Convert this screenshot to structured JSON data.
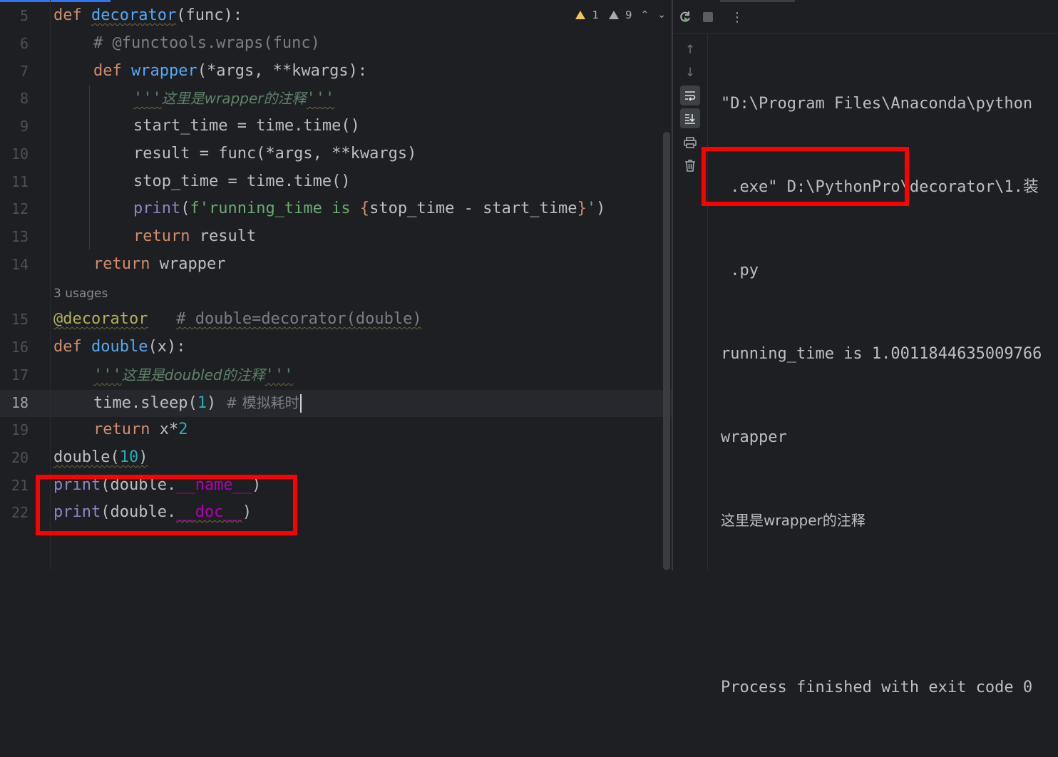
{
  "editor": {
    "line_numbers": [
      "5",
      "6",
      "7",
      "8",
      "9",
      "10",
      "11",
      "12",
      "13",
      "14",
      "15",
      "16",
      "17",
      "18",
      "19",
      "20",
      "21",
      "22"
    ],
    "active_line": "18",
    "usages_hint": "3 usages",
    "inspections": {
      "warnings": "1",
      "weak_warnings": "9"
    },
    "code": {
      "l5": {
        "kw": "def",
        "name": "decorator",
        "rest": "(func):"
      },
      "l6": {
        "comment": "# @functools.wraps(func)"
      },
      "l7": {
        "kw": "def",
        "name": "wrapper",
        "rest": "(*args, **kwargs):"
      },
      "l8": {
        "doc_a": "'''",
        "doc_b": "这里是wrapper的注释",
        "doc_c": "'''"
      },
      "l9": {
        "text": "start_time = time.time()"
      },
      "l10": {
        "text": "result = func(*args, **kwargs)"
      },
      "l11": {
        "text": "stop_time = time.time()"
      },
      "l12": {
        "builtin": "print",
        "p1": "(",
        "str_a": "f'running_time is ",
        "brace_open": "{",
        "expr": "stop_time - start_time",
        "brace_close": "}",
        "str_b": "'",
        "p2": ")"
      },
      "l13": {
        "kw": "return",
        "rest": " result"
      },
      "l14": {
        "kw": "return",
        "rest": " wrapper"
      },
      "l15": {
        "decorator": "@decorator",
        "comment": "# double=decorator(double)"
      },
      "l16": {
        "kw": "def",
        "name": "double",
        "rest": "(x):"
      },
      "l17": {
        "doc_a": "'''",
        "doc_b": "这里是doubled的注释",
        "doc_c": "'''"
      },
      "l18": {
        "text": "time.sleep(",
        "num": "1",
        "rest": ")",
        "comment": "# 模拟耗时"
      },
      "l19": {
        "kw": "return",
        "rest": " x*",
        "num": "2"
      },
      "l20": {
        "text": "double(",
        "num": "10",
        "rest": ")"
      },
      "l21": {
        "builtin": "print",
        "mid": "(double.",
        "dunder": "__name__",
        "rest": ")"
      },
      "l22": {
        "builtin": "print",
        "mid": "(double.",
        "dunder": "__doc__",
        "rest": ")"
      }
    }
  },
  "run_panel": {
    "toolbar_icons": [
      "rerun-icon",
      "stop-icon",
      "more-icon"
    ],
    "side_icons": [
      "up-arrow-icon",
      "down-arrow-icon",
      "soft-wrap-icon",
      "scroll-to-end-icon",
      "print-icon",
      "trash-icon"
    ],
    "console_lines": [
      "\"D:\\Program Files\\Anaconda\\python",
      " .exe\" D:\\PythonPro\\decorator\\1.装",
      " .py",
      "running_time is 1.0011844635009766",
      "wrapper",
      "这里是wrapper的注释",
      "",
      "Process finished with exit code 0"
    ]
  },
  "colors": {
    "background": "#1e1f22",
    "keyword": "#cf8e6d",
    "function": "#56a8f5",
    "docstring": "#5f826b",
    "highlight_box": "#ff0000"
  }
}
